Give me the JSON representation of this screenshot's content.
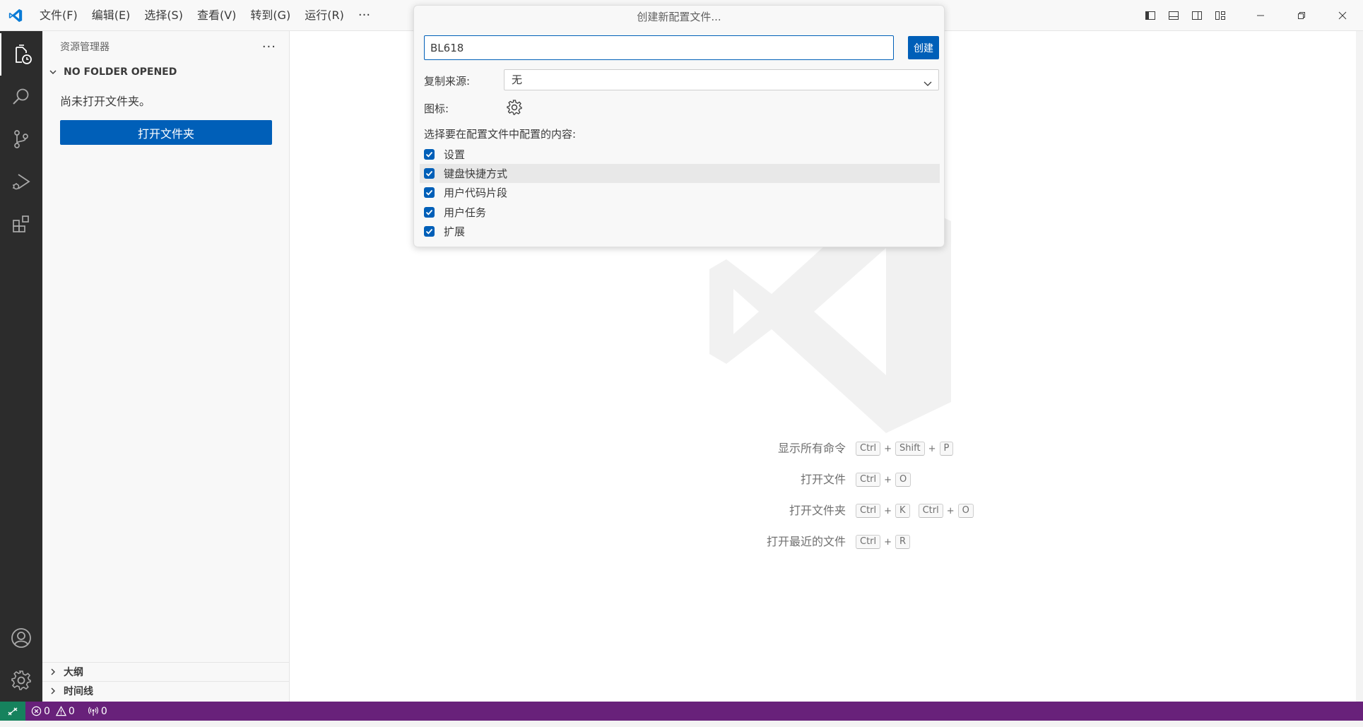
{
  "menu": {
    "items": [
      "文件(F)",
      "编辑(E)",
      "选择(S)",
      "查看(V)",
      "转到(G)",
      "运行(R)"
    ],
    "more": "···"
  },
  "sidebar": {
    "title": "资源管理器",
    "more": "···",
    "folder_section": "NO FOLDER OPENED",
    "empty_message": "尚未打开文件夹。",
    "open_folder_button": "打开文件夹",
    "outline_section": "大纲",
    "timeline_section": "时间线"
  },
  "dialog": {
    "title": "创建新配置文件...",
    "name_value": "BL618",
    "create_button": "创建",
    "copy_from_label": "复制来源:",
    "copy_from_value": "无",
    "icon_label": "图标:",
    "contents_label": "选择要在配置文件中配置的内容:",
    "options": [
      {
        "label": "设置",
        "checked": true
      },
      {
        "label": "键盘快捷方式",
        "checked": true
      },
      {
        "label": "用户代码片段",
        "checked": true
      },
      {
        "label": "用户任务",
        "checked": true
      },
      {
        "label": "扩展",
        "checked": true
      }
    ]
  },
  "shortcuts": {
    "show_all_commands": "显示所有命令",
    "open_file": "打开文件",
    "open_folder": "打开文件夹",
    "open_recent": "打开最近的文件",
    "keys": {
      "ctrl": "Ctrl",
      "shift": "Shift",
      "p": "P",
      "o": "O",
      "k": "K",
      "r": "R",
      "plus": "+"
    }
  },
  "statusbar": {
    "errors": "0",
    "warnings": "0",
    "ports": "0"
  },
  "colors": {
    "accent": "#005fb8",
    "statusbar": "#68217a",
    "remote": "#16825d",
    "activitybar": "#2c2c2c"
  }
}
